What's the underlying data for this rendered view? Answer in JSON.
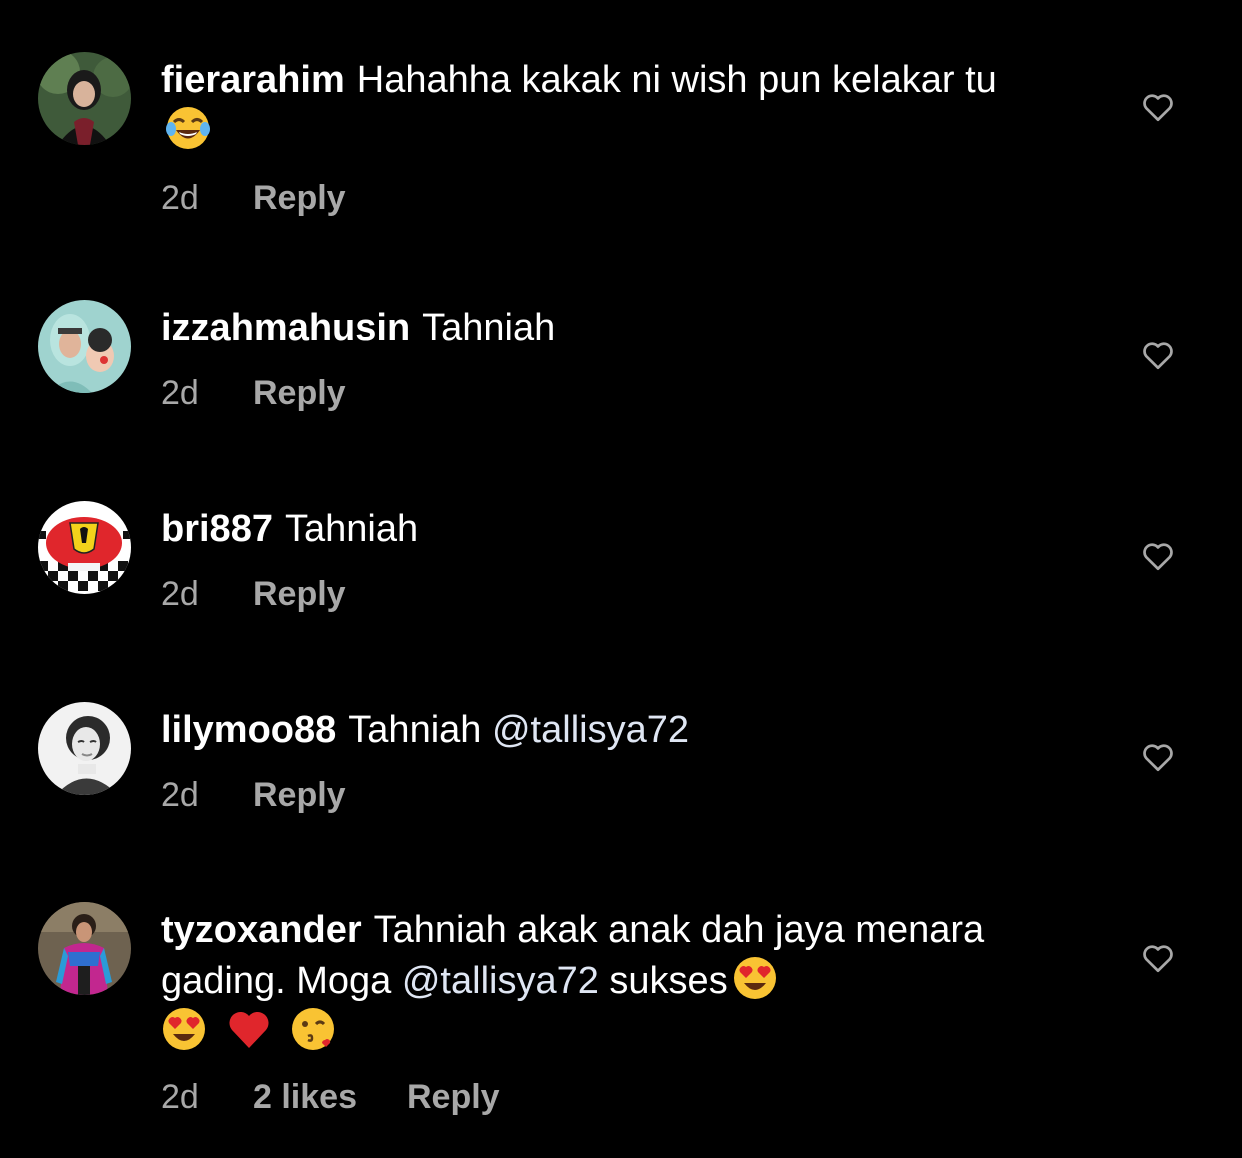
{
  "colors": {
    "background": "#000000",
    "text": "#ffffff",
    "secondary": "#a8a8a8"
  },
  "comments": [
    {
      "username": "fierarahim",
      "text_before": "Hahahha kakak ni wish pun kelakar tu",
      "emoji": [
        "face-with-tears-of-joy"
      ],
      "time": "2d",
      "reply": "Reply"
    },
    {
      "username": "izzahmahusin",
      "text_before": "Tahniah",
      "time": "2d",
      "reply": "Reply"
    },
    {
      "username": "bri887",
      "text_before": "Tahniah",
      "time": "2d",
      "reply": "Reply"
    },
    {
      "username": "lilymoo88",
      "text_before": "Tahniah",
      "mention": "@tallisya72",
      "time": "2d",
      "reply": "Reply"
    },
    {
      "username": "tyzoxander",
      "text_before": "Tahniah akak anak dah jaya menara gading. Moga",
      "mention": "@tallisya72",
      "text_after": "sukses",
      "emoji": [
        "heart-eyes",
        "heart-eyes",
        "red-heart",
        "face-blowing-kiss"
      ],
      "time": "2d",
      "likes": "2 likes",
      "reply": "Reply"
    }
  ]
}
